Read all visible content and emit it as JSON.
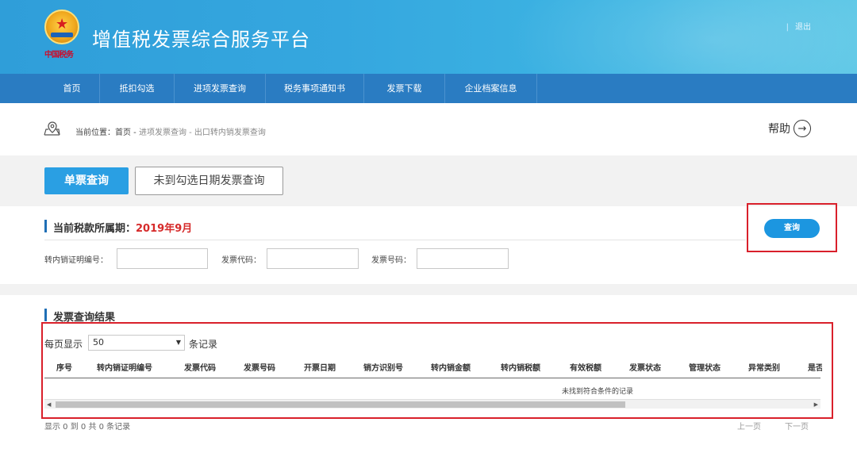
{
  "header": {
    "title": "增值税发票综合服务平台",
    "emblem_caption": "中国税务",
    "logout_separator": "|",
    "logout": "退出",
    "icon": "tax-emblem-icon"
  },
  "nav": {
    "tabs": [
      {
        "label": "首页"
      },
      {
        "label": "抵扣勾选"
      },
      {
        "label": "进项发票查询"
      },
      {
        "label": "税务事项通知书"
      },
      {
        "label": "发票下载"
      },
      {
        "label": "企业档案信息"
      }
    ]
  },
  "breadcrumb": {
    "prefix": "当前位置：首页 - ",
    "path": "进项发票查询 - 出口转内销发票查询",
    "icon": "location-pin-icon"
  },
  "help": {
    "label": "帮助",
    "icon": "arrow-right-circle-icon"
  },
  "query_tabs": {
    "single": "单票查询",
    "unchecked_date": "未到勾选日期发票查询"
  },
  "period": {
    "label": "当前税款所属期：",
    "value": "2019年9月"
  },
  "query_button": "查询",
  "fields": {
    "cert_no_label": "转内销证明编号：",
    "cert_no_value": "",
    "invoice_code_label": "发票代码：",
    "invoice_code_value": "",
    "invoice_no_label": "发票号码：",
    "invoice_no_value": ""
  },
  "results": {
    "title": "发票查询结果",
    "per_page_prefix": "每页显示",
    "per_page_value": "50",
    "per_page_suffix": "条记录",
    "columns": [
      "序号",
      "转内销证明编号",
      "发票代码",
      "发票号码",
      "开票日期",
      "销方识别号",
      "转内销金额",
      "转内销税额",
      "有效税额",
      "发票状态",
      "管理状态",
      "异常类别",
      "是否"
    ],
    "empty_message": "未找到符合条件的记录",
    "summary": "显示 0 到 0 共 0 条记录",
    "prev": "上一页",
    "next": "下一页"
  },
  "colors": {
    "header_blue": "#35a7df",
    "nav_blue": "#2a7cc2",
    "active_button": "#2a9fe3",
    "period_red": "#d62a2a",
    "highlight_red": "#d9202b"
  }
}
